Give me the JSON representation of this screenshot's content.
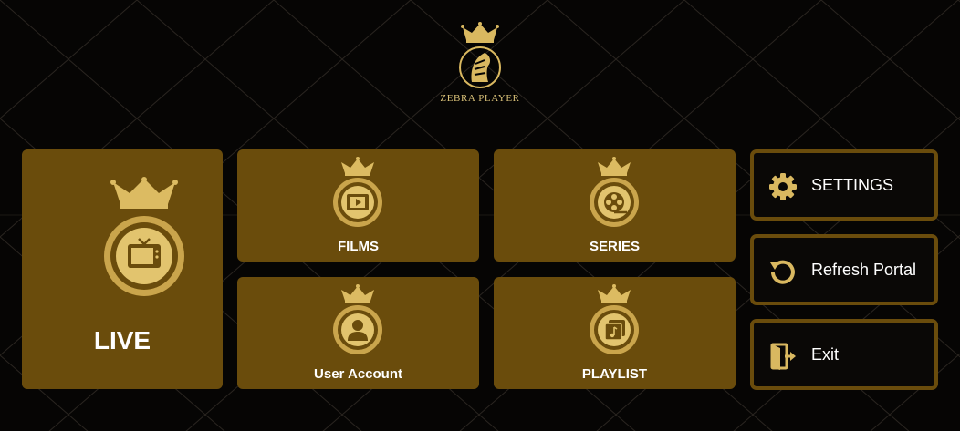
{
  "app": {
    "brand": "ZEBRA PLAYER"
  },
  "tiles": {
    "live": "LIVE",
    "films": "FILMS",
    "series": "SERIES",
    "user_account": "User Account",
    "playlist": "PLAYLIST"
  },
  "side_menu": {
    "settings": "SETTINGS",
    "refresh": "Refresh Portal",
    "exit": "Exit"
  },
  "icons": {
    "live": "tv-icon",
    "films": "film-icon",
    "series": "film-reel-icon",
    "user_account": "user-icon",
    "playlist": "music-playlist-icon",
    "settings": "gear-icon",
    "refresh": "refresh-icon",
    "exit": "exit-door-icon"
  },
  "colors": {
    "gold": "#d9b860",
    "tile_brown": "#6a4c0c",
    "background": "#060504"
  }
}
